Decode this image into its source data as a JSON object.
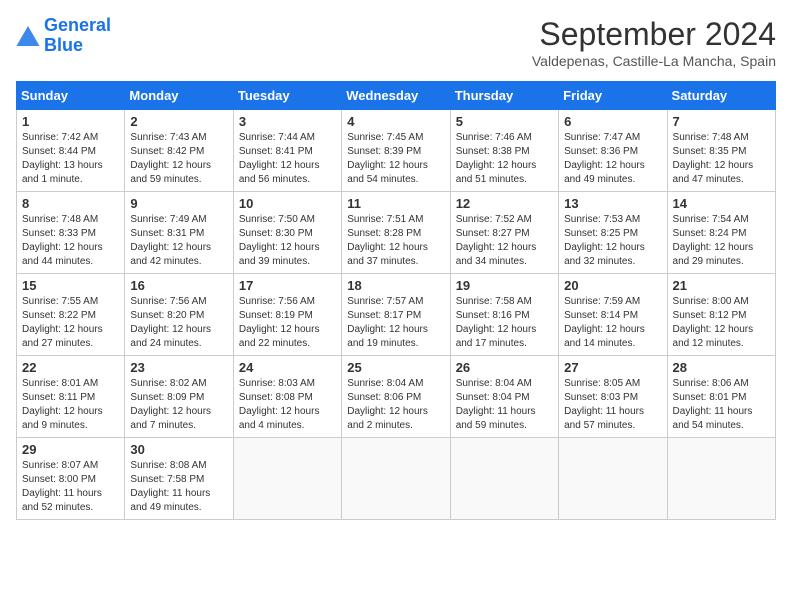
{
  "header": {
    "logo_line1": "General",
    "logo_line2": "Blue",
    "month_year": "September 2024",
    "location": "Valdepenas, Castille-La Mancha, Spain"
  },
  "weekdays": [
    "Sunday",
    "Monday",
    "Tuesday",
    "Wednesday",
    "Thursday",
    "Friday",
    "Saturday"
  ],
  "weeks": [
    [
      {
        "day": "1",
        "lines": [
          "Sunrise: 7:42 AM",
          "Sunset: 8:44 PM",
          "Daylight: 13 hours",
          "and 1 minute."
        ]
      },
      {
        "day": "2",
        "lines": [
          "Sunrise: 7:43 AM",
          "Sunset: 8:42 PM",
          "Daylight: 12 hours",
          "and 59 minutes."
        ]
      },
      {
        "day": "3",
        "lines": [
          "Sunrise: 7:44 AM",
          "Sunset: 8:41 PM",
          "Daylight: 12 hours",
          "and 56 minutes."
        ]
      },
      {
        "day": "4",
        "lines": [
          "Sunrise: 7:45 AM",
          "Sunset: 8:39 PM",
          "Daylight: 12 hours",
          "and 54 minutes."
        ]
      },
      {
        "day": "5",
        "lines": [
          "Sunrise: 7:46 AM",
          "Sunset: 8:38 PM",
          "Daylight: 12 hours",
          "and 51 minutes."
        ]
      },
      {
        "day": "6",
        "lines": [
          "Sunrise: 7:47 AM",
          "Sunset: 8:36 PM",
          "Daylight: 12 hours",
          "and 49 minutes."
        ]
      },
      {
        "day": "7",
        "lines": [
          "Sunrise: 7:48 AM",
          "Sunset: 8:35 PM",
          "Daylight: 12 hours",
          "and 47 minutes."
        ]
      }
    ],
    [
      {
        "day": "8",
        "lines": [
          "Sunrise: 7:48 AM",
          "Sunset: 8:33 PM",
          "Daylight: 12 hours",
          "and 44 minutes."
        ]
      },
      {
        "day": "9",
        "lines": [
          "Sunrise: 7:49 AM",
          "Sunset: 8:31 PM",
          "Daylight: 12 hours",
          "and 42 minutes."
        ]
      },
      {
        "day": "10",
        "lines": [
          "Sunrise: 7:50 AM",
          "Sunset: 8:30 PM",
          "Daylight: 12 hours",
          "and 39 minutes."
        ]
      },
      {
        "day": "11",
        "lines": [
          "Sunrise: 7:51 AM",
          "Sunset: 8:28 PM",
          "Daylight: 12 hours",
          "and 37 minutes."
        ]
      },
      {
        "day": "12",
        "lines": [
          "Sunrise: 7:52 AM",
          "Sunset: 8:27 PM",
          "Daylight: 12 hours",
          "and 34 minutes."
        ]
      },
      {
        "day": "13",
        "lines": [
          "Sunrise: 7:53 AM",
          "Sunset: 8:25 PM",
          "Daylight: 12 hours",
          "and 32 minutes."
        ]
      },
      {
        "day": "14",
        "lines": [
          "Sunrise: 7:54 AM",
          "Sunset: 8:24 PM",
          "Daylight: 12 hours",
          "and 29 minutes."
        ]
      }
    ],
    [
      {
        "day": "15",
        "lines": [
          "Sunrise: 7:55 AM",
          "Sunset: 8:22 PM",
          "Daylight: 12 hours",
          "and 27 minutes."
        ]
      },
      {
        "day": "16",
        "lines": [
          "Sunrise: 7:56 AM",
          "Sunset: 8:20 PM",
          "Daylight: 12 hours",
          "and 24 minutes."
        ]
      },
      {
        "day": "17",
        "lines": [
          "Sunrise: 7:56 AM",
          "Sunset: 8:19 PM",
          "Daylight: 12 hours",
          "and 22 minutes."
        ]
      },
      {
        "day": "18",
        "lines": [
          "Sunrise: 7:57 AM",
          "Sunset: 8:17 PM",
          "Daylight: 12 hours",
          "and 19 minutes."
        ]
      },
      {
        "day": "19",
        "lines": [
          "Sunrise: 7:58 AM",
          "Sunset: 8:16 PM",
          "Daylight: 12 hours",
          "and 17 minutes."
        ]
      },
      {
        "day": "20",
        "lines": [
          "Sunrise: 7:59 AM",
          "Sunset: 8:14 PM",
          "Daylight: 12 hours",
          "and 14 minutes."
        ]
      },
      {
        "day": "21",
        "lines": [
          "Sunrise: 8:00 AM",
          "Sunset: 8:12 PM",
          "Daylight: 12 hours",
          "and 12 minutes."
        ]
      }
    ],
    [
      {
        "day": "22",
        "lines": [
          "Sunrise: 8:01 AM",
          "Sunset: 8:11 PM",
          "Daylight: 12 hours",
          "and 9 minutes."
        ]
      },
      {
        "day": "23",
        "lines": [
          "Sunrise: 8:02 AM",
          "Sunset: 8:09 PM",
          "Daylight: 12 hours",
          "and 7 minutes."
        ]
      },
      {
        "day": "24",
        "lines": [
          "Sunrise: 8:03 AM",
          "Sunset: 8:08 PM",
          "Daylight: 12 hours",
          "and 4 minutes."
        ]
      },
      {
        "day": "25",
        "lines": [
          "Sunrise: 8:04 AM",
          "Sunset: 8:06 PM",
          "Daylight: 12 hours",
          "and 2 minutes."
        ]
      },
      {
        "day": "26",
        "lines": [
          "Sunrise: 8:04 AM",
          "Sunset: 8:04 PM",
          "Daylight: 11 hours",
          "and 59 minutes."
        ]
      },
      {
        "day": "27",
        "lines": [
          "Sunrise: 8:05 AM",
          "Sunset: 8:03 PM",
          "Daylight: 11 hours",
          "and 57 minutes."
        ]
      },
      {
        "day": "28",
        "lines": [
          "Sunrise: 8:06 AM",
          "Sunset: 8:01 PM",
          "Daylight: 11 hours",
          "and 54 minutes."
        ]
      }
    ],
    [
      {
        "day": "29",
        "lines": [
          "Sunrise: 8:07 AM",
          "Sunset: 8:00 PM",
          "Daylight: 11 hours",
          "and 52 minutes."
        ]
      },
      {
        "day": "30",
        "lines": [
          "Sunrise: 8:08 AM",
          "Sunset: 7:58 PM",
          "Daylight: 11 hours",
          "and 49 minutes."
        ]
      },
      {
        "day": "",
        "lines": []
      },
      {
        "day": "",
        "lines": []
      },
      {
        "day": "",
        "lines": []
      },
      {
        "day": "",
        "lines": []
      },
      {
        "day": "",
        "lines": []
      }
    ]
  ]
}
